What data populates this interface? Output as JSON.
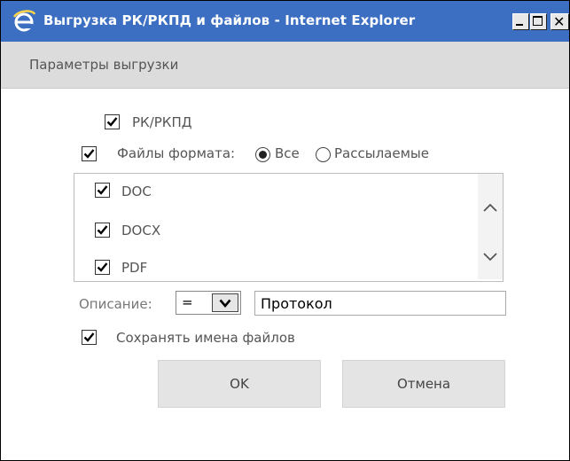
{
  "window": {
    "title": "Выгрузка РК/РКПД и файлов - Internet Explorer",
    "title_bar_color": "#3c6fc2",
    "buttons": {
      "minimize": "minimize-icon",
      "maximize": "maximize-icon",
      "close": "✕"
    }
  },
  "header": {
    "title": "Параметры выгрузки"
  },
  "options": {
    "rk_label": "РК/РКПД",
    "rk_checked": true,
    "files_label": "Файлы формата:",
    "files_checked": true,
    "radio_all_label": "Все",
    "radio_all_selected": true,
    "radio_sent_label": "Рассылаемые",
    "radio_sent_selected": false
  },
  "formats": [
    {
      "label": "DOC",
      "checked": true
    },
    {
      "label": "DOCX",
      "checked": true
    },
    {
      "label": "PDF",
      "checked": true
    }
  ],
  "description": {
    "label": "Описание:",
    "operator": "=",
    "value": "Протокол"
  },
  "save_names": {
    "label": "Сохранять имена файлов",
    "checked": true
  },
  "actions": {
    "ok_label": "OK",
    "cancel_label": "Отмена"
  }
}
